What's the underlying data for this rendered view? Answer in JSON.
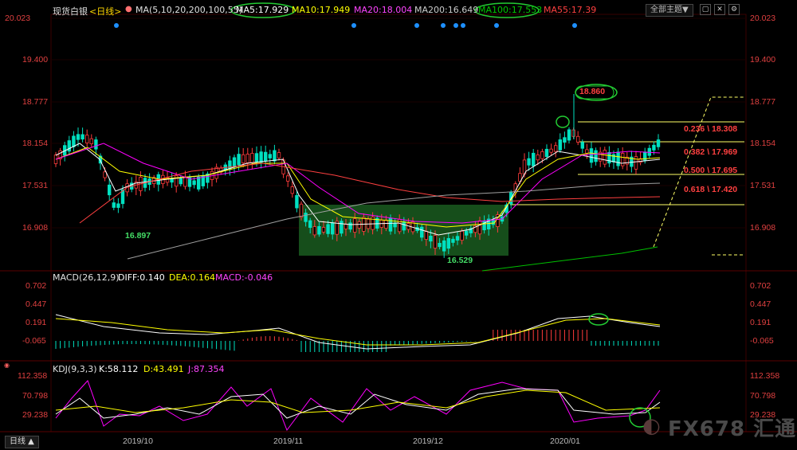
{
  "header": {
    "instrument": "现货白银",
    "period_tag": "<日线>",
    "ma_params": "MA(5,10,20,200,100,55)",
    "ma5": "MA5:17.929",
    "ma10": "MA10:17.949",
    "ma20": "MA20:18.004",
    "ma200": "MA200:16.649",
    "ma100": "MA100:17.553",
    "ma55": "MA55:17.39",
    "theme_button": "全部主题▼"
  },
  "colors": {
    "up": "#ff3b3b",
    "down": "#00e0c0",
    "ma5": "#ffffff",
    "ma10": "#ffff00",
    "ma20": "#ff00ff",
    "ma200": "#a0a0a0",
    "ma100": "#00c000",
    "ma55": "#ff4040",
    "fib": "#ffff66",
    "highlight_box": "#1a5c20"
  },
  "price_axis": [
    "20.023",
    "19.400",
    "18.777",
    "18.154",
    "17.531",
    "16.908"
  ],
  "annotations": {
    "low1": "16.897",
    "low2": "16.529",
    "high": "18.860"
  },
  "fib_levels": [
    {
      "label": "0.236 \\ 18.308"
    },
    {
      "label": "0.382 \\ 17.969"
    },
    {
      "label": "0.500 \\ 17.695"
    },
    {
      "label": "0.618 \\ 17.420"
    }
  ],
  "macd": {
    "title": "MACD(26,12,9)",
    "diff": "DIFF:0.140",
    "dea": "DEA:0.164",
    "macd": "MACD:-0.046",
    "axis": [
      "0.702",
      "0.447",
      "0.191",
      "-0.065"
    ]
  },
  "kdj": {
    "title": "KDJ(9,3,3)",
    "k": "K:58.112",
    "d": "D:43.491",
    "j": "J:87.354",
    "axis": [
      "112.358",
      "70.798",
      "29.238"
    ]
  },
  "time_axis": [
    "2019/10",
    "2019/11",
    "2019/12",
    "2020/01"
  ],
  "period_button": "日线 ▲",
  "watermark": "FX678 汇通网"
}
